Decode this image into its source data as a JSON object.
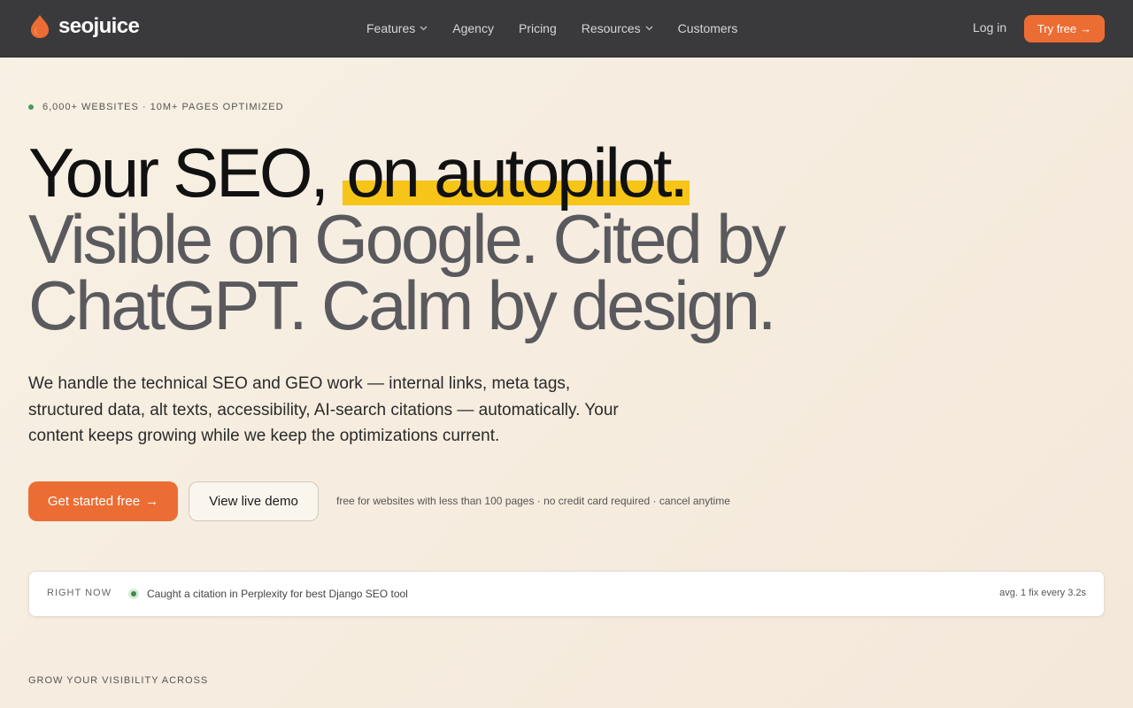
{
  "brand": {
    "name": "seojuice",
    "accent": "#ec6d33",
    "highlight": "#f7c517"
  },
  "nav": {
    "items": [
      {
        "label": "Features",
        "has_dropdown": true
      },
      {
        "label": "Agency",
        "has_dropdown": false
      },
      {
        "label": "Pricing",
        "has_dropdown": false
      },
      {
        "label": "Resources",
        "has_dropdown": true
      },
      {
        "label": "Customers",
        "has_dropdown": false
      }
    ],
    "login_label": "Log in",
    "try_label": "Try free",
    "try_arrow": "→"
  },
  "hero": {
    "eyebrow": "6,000+ WEBSITES · 10M+ PAGES OPTIMIZED",
    "headline_part1": "Your SEO, ",
    "headline_highlight": "on autopilot.",
    "headline_part2": "Visible on Google. Cited by ChatGPT. Calm by design.",
    "subtext": "We handle the technical SEO and GEO work — internal links, meta tags, structured data, alt texts, accessibility, AI-search citations — automatically. Your content keeps growing while we keep the optimizations current.",
    "cta_primary": "Get started free",
    "cta_primary_arrow": "→",
    "cta_secondary": "View live demo",
    "fineprint": "free for websites with less than 100 pages · no credit card required · cancel anytime"
  },
  "live": {
    "label": "RIGHT NOW",
    "message": "Caught a citation in Perplexity for best Django SEO tool",
    "avg": "avg. 1 fix every 3.2s"
  },
  "section": {
    "label": "GROW YOUR VISIBILITY ACROSS"
  }
}
